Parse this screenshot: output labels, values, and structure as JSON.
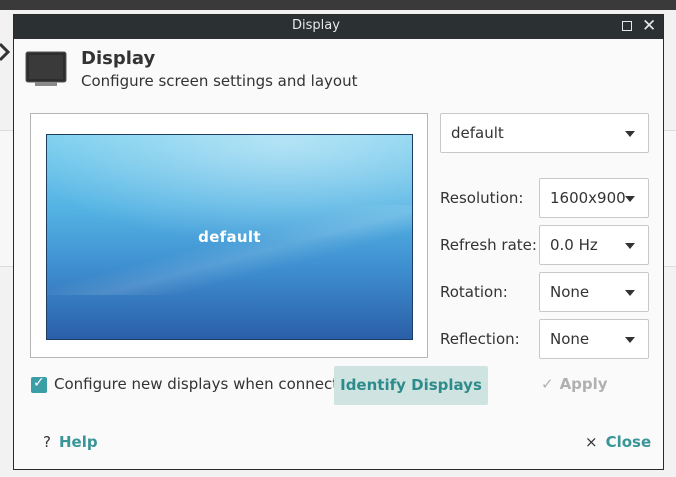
{
  "window": {
    "title": "Display",
    "maximize_icon": "maximize-icon",
    "close_icon": "close-icon",
    "close_glyph": "✕"
  },
  "header": {
    "icon": "monitor-icon",
    "title": "Display",
    "subtitle": "Configure screen settings and layout"
  },
  "preview": {
    "display_label": "default"
  },
  "display_select": {
    "value": "default"
  },
  "settings": {
    "resolution": {
      "label": "Resolution:",
      "value": "1600x900"
    },
    "refresh_rate": {
      "label": "Refresh rate:",
      "value": "0.0 Hz"
    },
    "rotation": {
      "label": "Rotation:",
      "value": "None"
    },
    "reflection": {
      "label": "Reflection:",
      "value": "None"
    }
  },
  "options": {
    "configure_new_displays": {
      "label": "Configure new displays when connected",
      "checked": true
    }
  },
  "buttons": {
    "identify": "Identify Displays",
    "apply": "Apply",
    "apply_glyph": "✓",
    "help": "Help",
    "help_glyph": "?",
    "close": "Close",
    "close_glyph": "×"
  },
  "colors": {
    "accent": "#3b9ea6",
    "titlebar": "#2b3033",
    "identify_bg": "#cfe4e1"
  }
}
